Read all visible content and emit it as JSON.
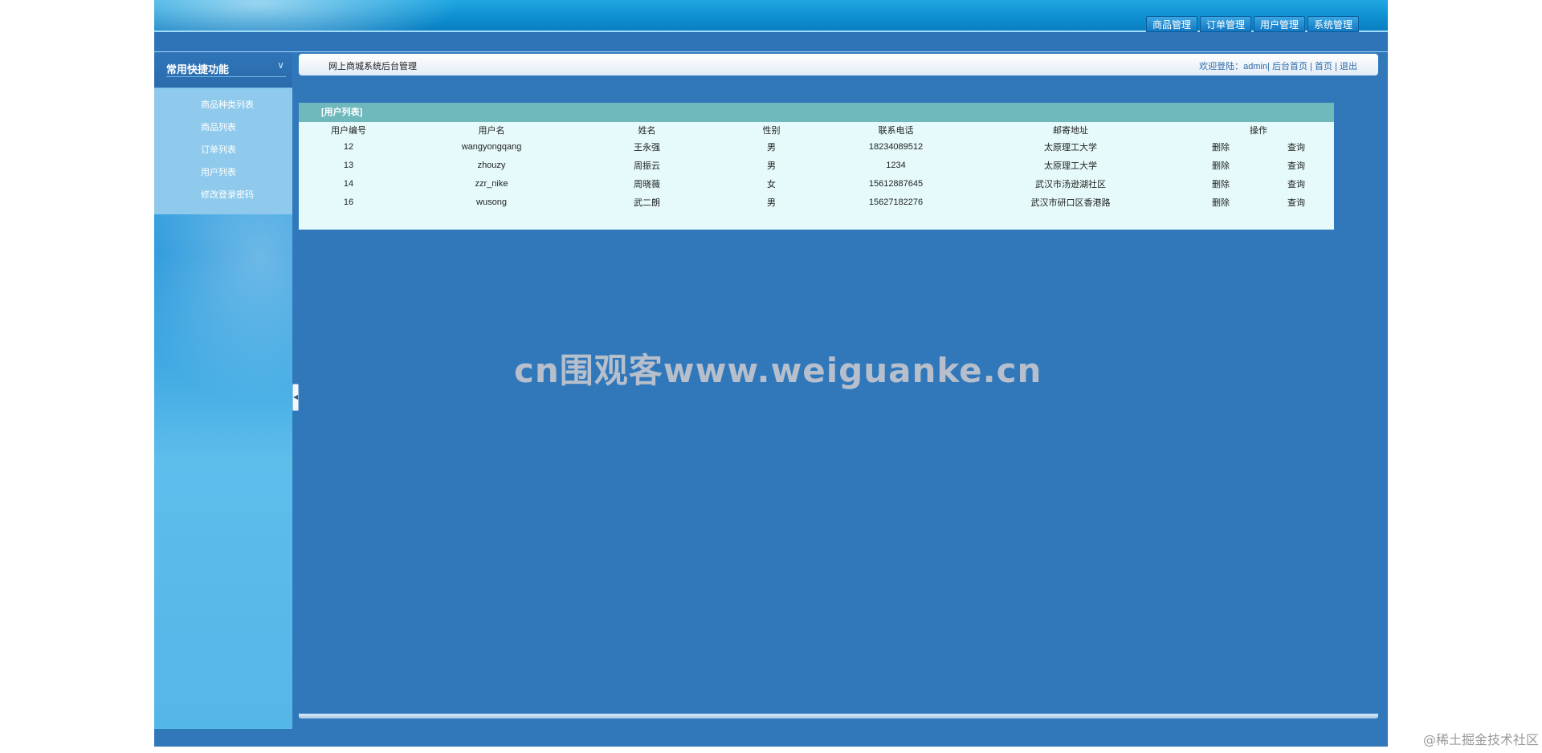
{
  "top_nav": [
    "商品管理",
    "订单管理",
    "用户管理",
    "系统管理"
  ],
  "sidebar": {
    "title": "常用快捷功能",
    "items": [
      "商品种类列表",
      "商品列表",
      "订单列表",
      "用户列表",
      "修改登录密码"
    ]
  },
  "header": {
    "breadcrumb": "网上商城系统后台管理",
    "welcome_label": "欢迎登陆：",
    "username": "admin",
    "links": [
      "后台首页",
      "首页",
      "退出"
    ]
  },
  "user_table": {
    "title": "[用户列表]",
    "columns": [
      "用户编号",
      "用户名",
      "姓名",
      "性别",
      "联系电话",
      "邮寄地址",
      "操作"
    ],
    "rows": [
      {
        "id": "12",
        "username": "wangyongqang",
        "name": "王永强",
        "gender": "男",
        "phone": "18234089512",
        "address": "太原理工大学",
        "delete": "删除",
        "query": "查询"
      },
      {
        "id": "13",
        "username": "zhouzy",
        "name": "周振云",
        "gender": "男",
        "phone": "1234",
        "address": "太原理工大学",
        "delete": "删除",
        "query": "查询"
      },
      {
        "id": "14",
        "username": "zzr_nike",
        "name": "周晓薇",
        "gender": "女",
        "phone": "15612887645",
        "address": "武汉市汤逊湖社区",
        "delete": "删除",
        "query": "查询"
      },
      {
        "id": "16",
        "username": "wusong",
        "name": "武二朗",
        "gender": "男",
        "phone": "15627182276",
        "address": "武汉市研口区香港路",
        "delete": "删除",
        "query": "查询"
      }
    ]
  },
  "watermark": "cn围观客www.weiguanke.cn",
  "credit": "@稀土掘金技术社区",
  "colors": {
    "background": "#3178bb",
    "panel": "#e6fafb",
    "panel_header": "#6fb8bc",
    "sidebar_menu": "#8fcaec"
  }
}
